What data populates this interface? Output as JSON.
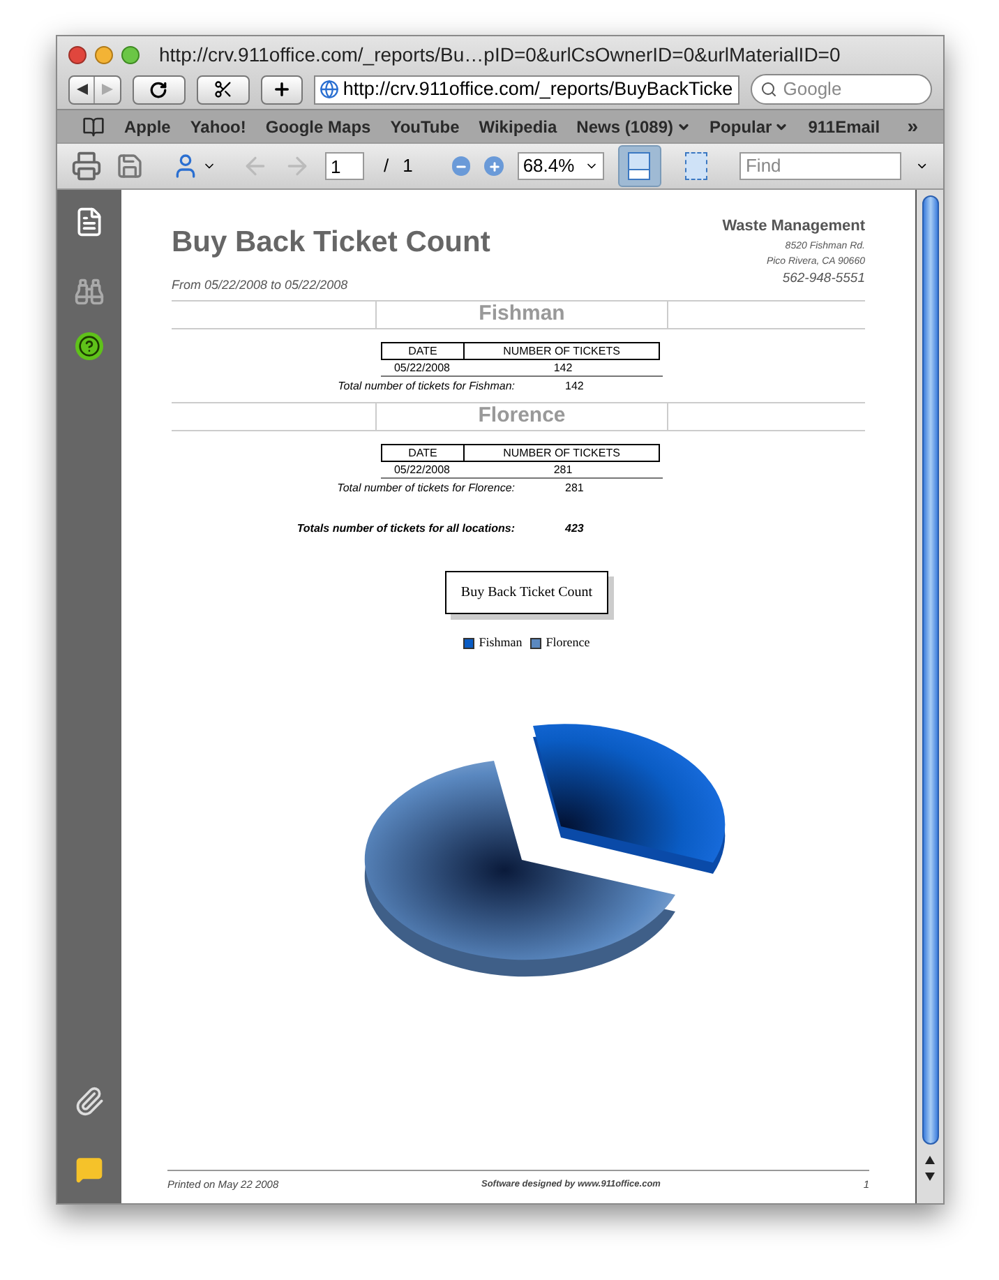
{
  "window": {
    "title": "http://crv.911office.com/_reports/Bu…pID=0&urlCsOwnerID=0&urlMaterialID=0"
  },
  "toolbar": {
    "url": "http://crv.911office.com/_reports/BuyBackTicke",
    "search_placeholder": "Google"
  },
  "bookmarks": [
    {
      "label": "Apple",
      "has_menu": false
    },
    {
      "label": "Yahoo!",
      "has_menu": false
    },
    {
      "label": "Google Maps",
      "has_menu": false
    },
    {
      "label": "YouTube",
      "has_menu": false
    },
    {
      "label": "Wikipedia",
      "has_menu": false
    },
    {
      "label": "News (1089)",
      "has_menu": true
    },
    {
      "label": "Popular",
      "has_menu": true
    },
    {
      "label": "911Email",
      "has_menu": false
    }
  ],
  "bookmarks_overflow": "»",
  "pdf_toolbar": {
    "page": "1",
    "page_separator": "/",
    "page_total": "1",
    "zoom": "68.4%",
    "find_placeholder": "Find",
    "view_buttons": [
      {
        "kind": "fit-width",
        "selected": true
      },
      {
        "kind": "fit-page",
        "selected": false
      }
    ]
  },
  "report": {
    "title": "Buy Back Ticket Count",
    "date_range": "From 05/22/2008 to 05/22/2008",
    "company": {
      "name": "Waste Management",
      "address": [
        "8520 Fishman Rd.",
        "Pico Rivera, CA 90660"
      ],
      "phone": "562-948-5551"
    },
    "sections": [
      {
        "name": "Fishman",
        "columns": [
          "DATE",
          "NUMBER OF TICKETS"
        ],
        "rows": [
          {
            "date": "05/22/2008",
            "count": "142"
          }
        ],
        "total_label": "Total number of tickets for Fishman:",
        "total_value": "142"
      },
      {
        "name": "Florence",
        "columns": [
          "DATE",
          "NUMBER OF TICKETS"
        ],
        "rows": [
          {
            "date": "05/22/2008",
            "count": "281"
          }
        ],
        "total_label": "Total number of tickets for Florence:",
        "total_value": "281"
      }
    ],
    "grand_total_label": "Totals number of tickets for all locations:",
    "grand_total_value": "423",
    "chart_title": "Buy Back Ticket Count",
    "legend": [
      {
        "label": "Fishman",
        "color": "#0a5cc4"
      },
      {
        "label": "Florence",
        "color": "#5a88c0"
      }
    ],
    "footer": {
      "printed": "Printed on May 22 2008",
      "software": "Software designed by www.911office.com",
      "page": "1"
    }
  }
}
